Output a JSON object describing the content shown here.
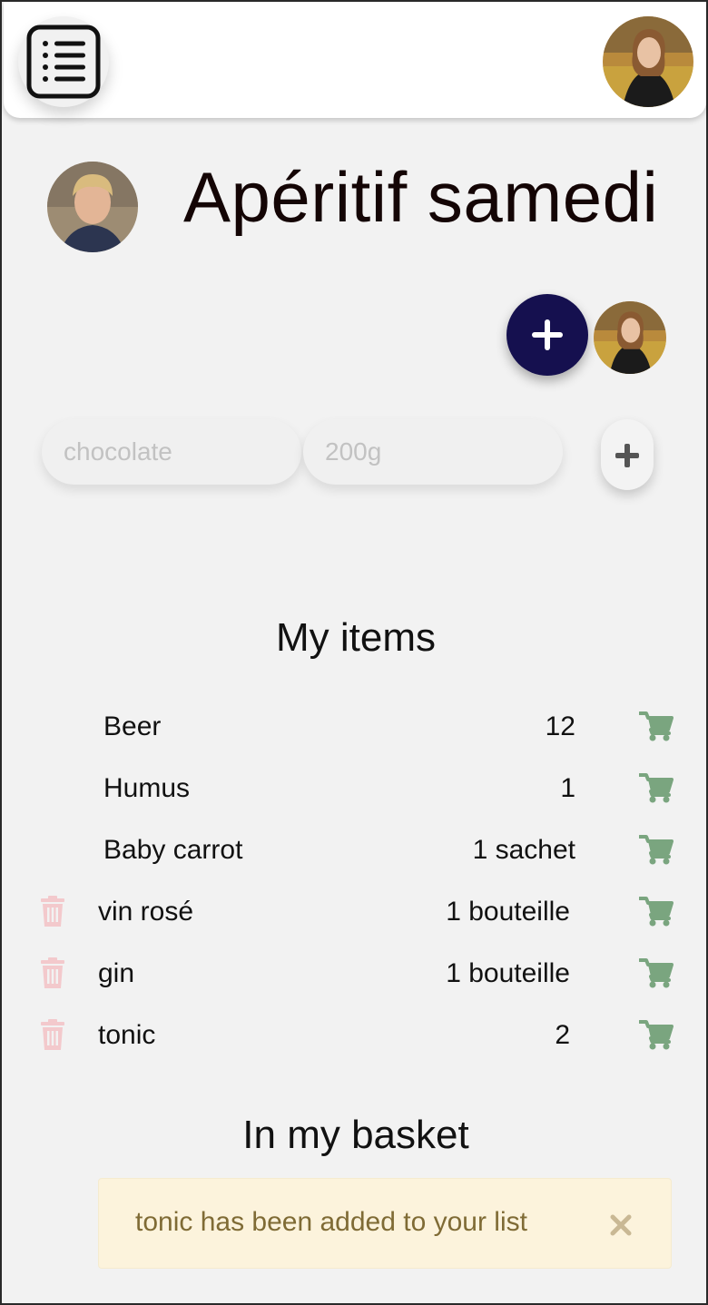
{
  "header": {
    "menu_icon": "list-menu-icon",
    "user_avatar": "user-avatar"
  },
  "list": {
    "title": "Apéritif samedi",
    "owner_avatar": "owner-avatar",
    "add_member_icon": "plus-icon",
    "member_avatar": "member-avatar"
  },
  "new_item": {
    "name_placeholder": "chocolate",
    "quantity_placeholder": "200g",
    "add_icon": "plus-icon"
  },
  "my_items": {
    "heading": "My items",
    "items": [
      {
        "name": "Beer",
        "quantity": "12",
        "deletable": false
      },
      {
        "name": "Humus",
        "quantity": "1",
        "deletable": false
      },
      {
        "name": "Baby carrot",
        "quantity": "1 sachet",
        "deletable": false
      },
      {
        "name": "vin rosé",
        "quantity": "1 bouteille",
        "deletable": true
      },
      {
        "name": "gin",
        "quantity": "1 bouteille",
        "deletable": true
      },
      {
        "name": "tonic",
        "quantity": "2",
        "deletable": true
      }
    ]
  },
  "basket": {
    "heading": "In my basket",
    "alert_text": "tonic has been added to your list",
    "close_icon": "close-icon"
  },
  "colors": {
    "primary": "#15104f",
    "cart": "#7aa57f",
    "trash": "#f3c9cc",
    "alert_bg": "#fcf3dc",
    "alert_text": "#7f6b35"
  }
}
